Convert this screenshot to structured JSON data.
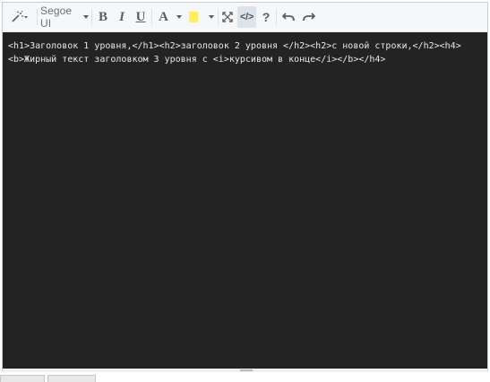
{
  "toolbar": {
    "font_name": "Segoe UI",
    "bold_label": "B",
    "italic_label": "I",
    "underline_label": "U",
    "font_color_label": "A",
    "code_view_label": "</>",
    "help_label": "?",
    "highlight_color": "#ffef5a"
  },
  "editor": {
    "content": "<h1>Заголовок 1 уровня,</h1><h2>заголовок 2 уровня </h2><h2>с новой строки,</h2><h4><b>Жирный текст заголовком 3 уровня с <i>курсивом в конце</i></b></h4>",
    "background": "#232323"
  }
}
